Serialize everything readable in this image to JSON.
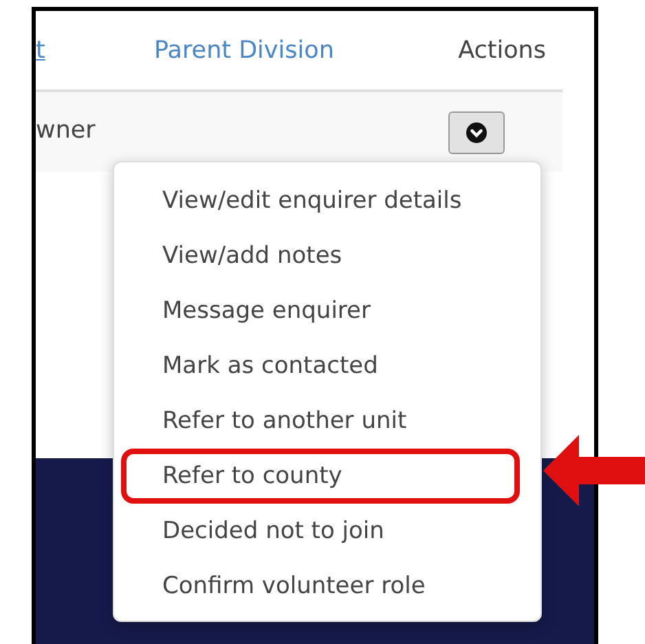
{
  "table": {
    "columns": [
      {
        "label": "t",
        "kind": "link"
      },
      {
        "label": "Parent Division",
        "kind": "sortable"
      },
      {
        "label": "Actions",
        "kind": "plain"
      }
    ],
    "rows": [
      {
        "cells": [
          "wner"
        ]
      }
    ]
  },
  "actions_menu": {
    "expanded": true,
    "items": [
      {
        "label": "View/edit enquirer details",
        "highlighted": false
      },
      {
        "label": "View/add notes",
        "highlighted": false
      },
      {
        "label": "Message enquirer",
        "highlighted": false
      },
      {
        "label": "Mark as contacted",
        "highlighted": false
      },
      {
        "label": "Refer to another unit",
        "highlighted": false
      },
      {
        "label": "Refer to county",
        "highlighted": true
      },
      {
        "label": "Decided not to join",
        "highlighted": false
      },
      {
        "label": "Confirm volunteer role",
        "highlighted": false
      }
    ]
  }
}
